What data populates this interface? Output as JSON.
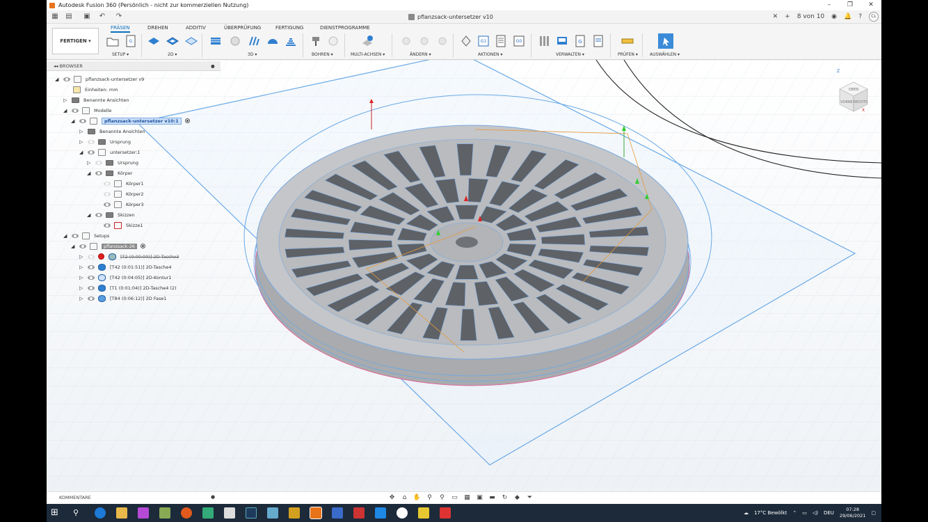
{
  "window": {
    "title": "Autodesk Fusion 360 (Persönlich - nicht zur kommerziellen Nutzung)",
    "minimize": "–",
    "restore": "❐",
    "close": "✕"
  },
  "doc_tab": {
    "name": "pflanzsack-untersetzer v10",
    "close": "✕",
    "add": "+",
    "jobs": "8 von 10"
  },
  "user_initials": "CL",
  "workspace": "FERTIGEN ▾",
  "ribbon_tabs": [
    "FRÄSEN",
    "DREHEN",
    "ADDITIV",
    "ÜBERPRÜFUNG",
    "FERTIGUNG",
    "DIENSTPROGRAMME"
  ],
  "ribbon_groups": [
    "SETUP ▾",
    "2D ▾",
    "3D ▾",
    "BOHREN ▾",
    "MULTI-ACHSEN ▾",
    "ÄNDERN ▾",
    "AKTIONEN ▾",
    "VERWALTEN ▾",
    "PRÜFEN ▾",
    "AUSWÄHLEN ▾"
  ],
  "browser": {
    "title": "BROWSER",
    "items": [
      {
        "label": "pflanzsack-untersetzer v9"
      },
      {
        "label": "Einheiten: mm"
      },
      {
        "label": "Benannte Ansichten"
      },
      {
        "label": "Modelle"
      },
      {
        "label": "pflanzsack-untersetzer v10:1"
      },
      {
        "label": "Benannte Ansichten"
      },
      {
        "label": "Ursprung"
      },
      {
        "label": "untersetzer:1"
      },
      {
        "label": "Ursprung"
      },
      {
        "label": "Körper"
      },
      {
        "label": "Körper1"
      },
      {
        "label": "Körper2"
      },
      {
        "label": "Körper3"
      },
      {
        "label": "Skizzen"
      },
      {
        "label": "Skizze1"
      },
      {
        "label": "Setups"
      },
      {
        "label": "pflanzsack-26"
      },
      {
        "label": "[T2 (0:00:00)] 2D-Tasche3"
      },
      {
        "label": "[T42 (0:01:51)] 2D-Tasche4"
      },
      {
        "label": "[T42 (0:04:05)] 2D-Kontur1"
      },
      {
        "label": "[T1 (0:01:04)] 2D-Tasche4 (2)"
      },
      {
        "label": "[T84 (0:06:12)] 2D Fase1"
      }
    ]
  },
  "comments_label": "KOMMENTARE",
  "viewcube": {
    "top": "OBEN",
    "front": "VORNE",
    "right": "RECHTS",
    "z": "Z",
    "x": "X",
    "y": "Y"
  },
  "taskbar": {
    "weather": "17°C  Bewölkt",
    "lang": "DEU",
    "time": "07:28",
    "date": "29/06/2021"
  }
}
